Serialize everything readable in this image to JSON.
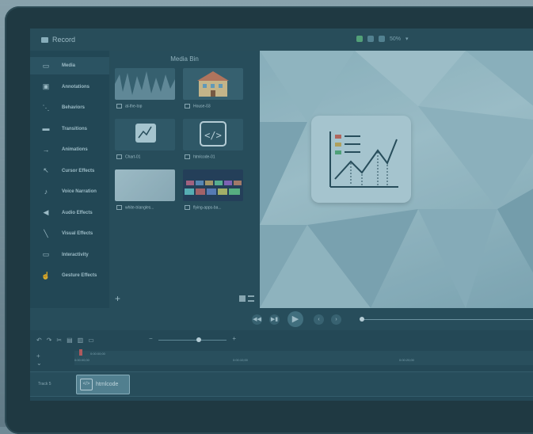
{
  "window": {
    "title": "Record",
    "zoom": "50%"
  },
  "tools": [
    {
      "label": "Media",
      "icon": "media-icon",
      "glyph": "▭",
      "active": true
    },
    {
      "label": "Annotations",
      "icon": "annotations-icon",
      "glyph": "▣",
      "active": false
    },
    {
      "label": "Behaviors",
      "icon": "behaviors-icon",
      "glyph": "⋱",
      "active": false
    },
    {
      "label": "Transitions",
      "icon": "transitions-icon",
      "glyph": "▬",
      "active": false
    },
    {
      "label": "Animations",
      "icon": "animations-icon",
      "glyph": "→",
      "active": false
    },
    {
      "label": "Cursor Effects",
      "icon": "cursor-icon",
      "glyph": "↖",
      "active": false
    },
    {
      "label": "Voice Narration",
      "icon": "microphone-icon",
      "glyph": "♪",
      "active": false
    },
    {
      "label": "Audio Effects",
      "icon": "speaker-icon",
      "glyph": "◀",
      "active": false
    },
    {
      "label": "Visual Effects",
      "icon": "wand-icon",
      "glyph": "╲",
      "active": false
    },
    {
      "label": "Interactivity",
      "icon": "interactivity-icon",
      "glyph": "▭",
      "active": false
    },
    {
      "label": "Gesture Effects",
      "icon": "hand-icon",
      "glyph": "☝",
      "active": false
    }
  ],
  "media_bin": {
    "title": "Media Bin",
    "items": [
      {
        "label": "at-the-top",
        "kind": "audio"
      },
      {
        "label": "House-03",
        "kind": "image"
      },
      {
        "label": "Chart-01",
        "kind": "image"
      },
      {
        "label": "htmlcode-01",
        "kind": "image"
      },
      {
        "label": "white-triangles...",
        "kind": "image"
      },
      {
        "label": "flying-apps-ba...",
        "kind": "image"
      }
    ],
    "add_label": "+"
  },
  "timeline": {
    "ticks": [
      "0:00:00;00",
      "0:00:10;00",
      "0:00:20;00"
    ],
    "playhead_time": "0:00:00;00",
    "track_label": "Track 5",
    "clip_label": "htmlcode"
  },
  "colors": {
    "accent": "#d05a5a",
    "panel": "#244450",
    "canvas": "#9fc1cb"
  }
}
